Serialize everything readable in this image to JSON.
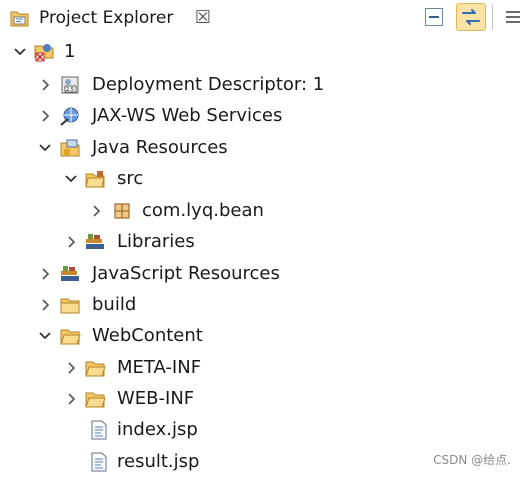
{
  "view": {
    "title": "Project Explorer",
    "close_symbol": "☒"
  },
  "toolbar": {
    "collapse_all": "collapse-all-icon",
    "link_with_editor": "link-with-editor-icon",
    "view_menu": "view-menu-icon"
  },
  "tree": {
    "project": {
      "label": "1",
      "expanded": true
    },
    "items": [
      {
        "label": "Deployment Descriptor: 1",
        "expanded": false
      },
      {
        "label": "JAX-WS Web Services",
        "expanded": false
      },
      {
        "label": "Java Resources",
        "expanded": true
      },
      {
        "label": "src",
        "expanded": true
      },
      {
        "label": "com.lyq.bean",
        "expanded": false
      },
      {
        "label": "Libraries",
        "expanded": false
      },
      {
        "label": "JavaScript Resources",
        "expanded": false
      },
      {
        "label": "build",
        "expanded": false
      },
      {
        "label": "WebContent",
        "expanded": true
      },
      {
        "label": "META-INF",
        "expanded": false
      },
      {
        "label": "WEB-INF",
        "expanded": false
      },
      {
        "label": "index.jsp"
      },
      {
        "label": "result.jsp"
      }
    ]
  },
  "colors": {
    "folder": "#e9b44c",
    "selection_highlight": "#fbe3a6"
  },
  "watermark": "CSDN @给点."
}
